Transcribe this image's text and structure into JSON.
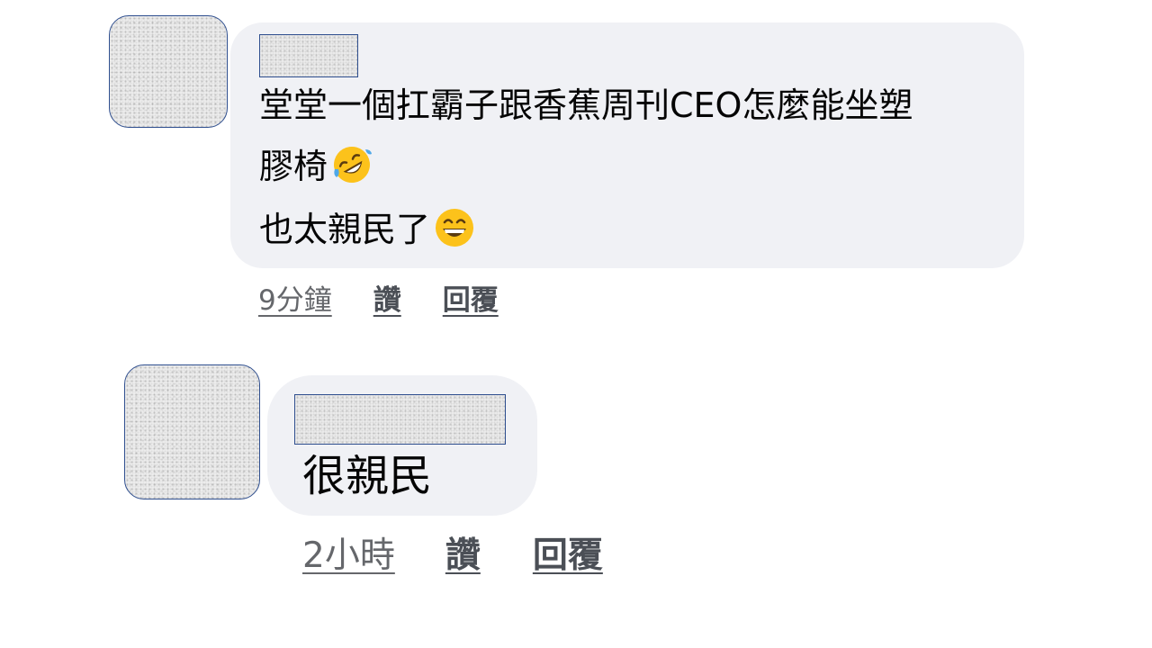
{
  "comments": [
    {
      "lines": [
        "堂堂一個扛霸子跟香蕉周刊CEO怎麼能坐塑",
        "膠椅",
        "也太親民了"
      ],
      "line2_emoji": "rolling-on-floor-laughing-emoji",
      "line3_emoji": "grinning-smiling-eyes-emoji",
      "time": "9分鐘",
      "like_label": "讚",
      "reply_label": "回覆"
    },
    {
      "lines": [
        "很親民"
      ],
      "time": "2小時",
      "like_label": "讚",
      "reply_label": "回覆"
    }
  ]
}
